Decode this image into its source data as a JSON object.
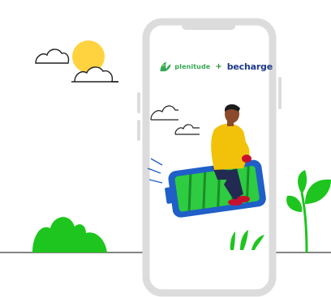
{
  "brand": {
    "partner_name": "plenitude",
    "plus_sign": "+",
    "product_name": "becharge"
  },
  "colors": {
    "brand_green": "#34a853",
    "becharge_navy": "#1f3b8c",
    "phone_frame": "#d9d9d9",
    "battery_blue": "#1f5fc7",
    "battery_green": "#2ecc40",
    "plant_green": "#1ec51e",
    "sun_yellow": "#ffd23f",
    "jacket_yellow": "#f2c20a"
  },
  "icons": [
    "sun-icon",
    "cloud-icon",
    "plant-icon",
    "bush-icon",
    "battery-icon",
    "rider-figure"
  ]
}
